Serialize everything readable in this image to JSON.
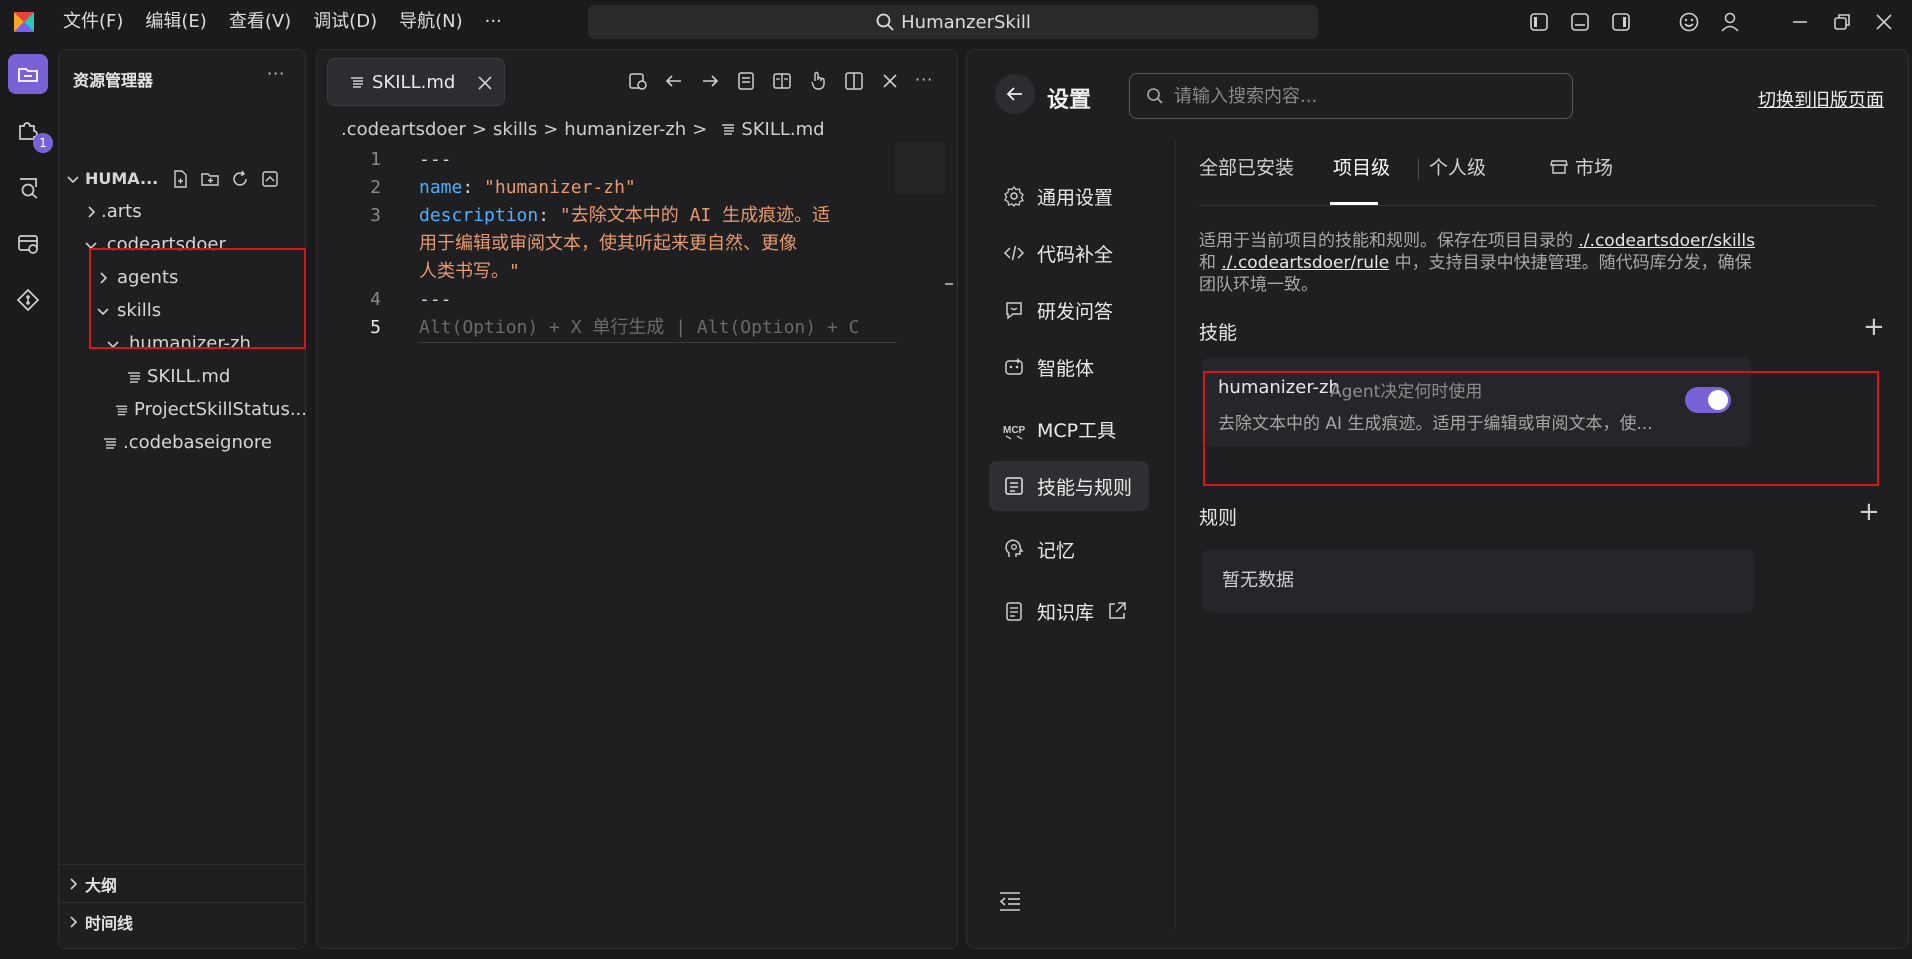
{
  "titlebar": {
    "menu": [
      "文件(F)",
      "编辑(E)",
      "查看(V)",
      "调试(D)",
      "导航(N)",
      "···"
    ],
    "search_text": "HumanzerSkill",
    "icons": [
      "layout-left-icon",
      "layout-bottom-icon",
      "layout-right-icon",
      "feedback-icon",
      "account-icon",
      "minimize-icon",
      "restore-icon",
      "close-icon"
    ]
  },
  "activitybar": {
    "items": [
      "explorer-icon",
      "extensions-icon",
      "search-icon",
      "remote-icon",
      "git-icon"
    ],
    "extensions_badge": "1"
  },
  "explorer": {
    "title": "资源管理器",
    "more": "···",
    "root": "HUMA...",
    "tree": [
      {
        "label": ".arts",
        "type": "folder",
        "expanded": false,
        "depth": 1
      },
      {
        "label": ".codeartsdoer",
        "type": "folder",
        "expanded": true,
        "depth": 1
      },
      {
        "label": "agents",
        "type": "folder",
        "expanded": false,
        "depth": 2
      },
      {
        "label": "skills",
        "type": "folder",
        "expanded": true,
        "depth": 2
      },
      {
        "label": "humanizer-zh",
        "type": "folder",
        "expanded": true,
        "depth": 3
      },
      {
        "label": "SKILL.md",
        "type": "file",
        "depth": 4
      },
      {
        "label": "ProjectSkillStatus...",
        "type": "file",
        "depth": 3
      },
      {
        "label": ".codebaseignore",
        "type": "file",
        "depth": 2
      }
    ],
    "outline": "大纲",
    "timeline": "时间线"
  },
  "editor": {
    "tab_label": "SKILL.md",
    "breadcrumb": [
      ".codeartsdoer",
      "skills",
      "humanizer-zh",
      "SKILL.md"
    ],
    "breadcrumb_sep": ">",
    "lines": {
      "n1": "1",
      "n2": "2",
      "n3": "3",
      "n4": "4",
      "n5": "5",
      "l1": "---",
      "l2_key": "name",
      "l2_colon": ": ",
      "l2_val": "\"humanizer-zh\"",
      "l3_key": "description",
      "l3_colon": ": ",
      "l3_val_a": "\"去除文本中的 AI 生成痕迹。适",
      "l3_val_b": "用于编辑或审阅文本，使其听起来更自然、更像",
      "l3_val_c": "人类书写。\"",
      "l4": "---",
      "l5_hint": "Alt(Option) + X 单行生成 | Alt(Option) + C"
    }
  },
  "settings": {
    "title": "设置",
    "search_placeholder": "请输入搜索内容...",
    "old_page_link": "切换到旧版页面",
    "nav": [
      {
        "label": "通用设置",
        "icon": "gear-icon"
      },
      {
        "label": "代码补全",
        "icon": "code-icon"
      },
      {
        "label": "研发问答",
        "icon": "chat-icon"
      },
      {
        "label": "智能体",
        "icon": "agent-icon"
      },
      {
        "label": "MCP工具",
        "icon": "mcp-icon"
      },
      {
        "label": "技能与规则",
        "icon": "rules-icon"
      },
      {
        "label": "记忆",
        "icon": "memory-icon"
      },
      {
        "label": "知识库",
        "icon": "knowledge-icon"
      }
    ],
    "active_nav": "技能与规则",
    "tabs": [
      "全部已安装",
      "项目级",
      "个人级",
      "市场"
    ],
    "active_tab": "项目级",
    "description": {
      "part1": "适用于当前项目的技能和规则。保存在项目目录的 ",
      "link1": "./.codeartsdoer/skills",
      "part2": " 和 ",
      "link2": "./.codeartsdoer/rule",
      "part3": " 中，支持目录中快捷管理。随代码库分发，确保团队环境一致。"
    },
    "skills_title": "技能",
    "skill": {
      "name": "humanizer-zh",
      "mode": "Agent决定何时使用",
      "desc": "去除文本中的 AI 生成痕迹。适用于编辑或审阅文本，使...",
      "enabled": true
    },
    "rules_title": "规则",
    "rules_empty": "暂无数据",
    "add": "+"
  },
  "colors": {
    "accent": "#7a62d6",
    "highlight": "#d7141a",
    "key": "#4fb0ff",
    "string": "#e69a70"
  }
}
